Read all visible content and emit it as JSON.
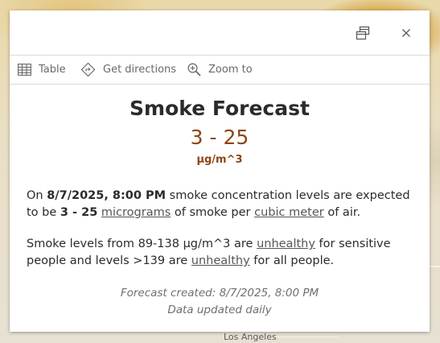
{
  "map": {
    "place_label": "Los Angeles"
  },
  "popup": {
    "header": {
      "dock_icon": "dock-icon",
      "close_icon": "close-icon"
    },
    "actions": [
      {
        "label": "Table",
        "icon": "table-icon"
      },
      {
        "label": "Get directions",
        "icon": "directions-icon"
      },
      {
        "label": "Zoom to",
        "icon": "zoom-in-icon"
      }
    ],
    "title": "Smoke Forecast",
    "range": "3 - 25",
    "unit": "µg/m^3",
    "paragraph1": {
      "pre": "On ",
      "datetime": "8/7/2025, 8:00 PM",
      "mid1": " smoke concentration levels are expected to be ",
      "range": "3 - 25",
      "mid2": " ",
      "link1": "micrograms",
      "mid3": " of smoke per ",
      "link2": "cubic meter",
      "post": " of air."
    },
    "paragraph2": {
      "pre": "Smoke levels from 89-138 µg/m^3 are ",
      "link1": "unhealthy",
      "mid": " for sensitive people and levels >139 are ",
      "link2": "unhealthy",
      "post": " for all people."
    },
    "footer": {
      "created": "Forecast created: 8/7/2025, 8:00 PM",
      "updated": "Data updated daily"
    }
  },
  "colors": {
    "accent": "#8e4512",
    "text": "#2b2b2b",
    "muted": "#6f6f6f"
  }
}
